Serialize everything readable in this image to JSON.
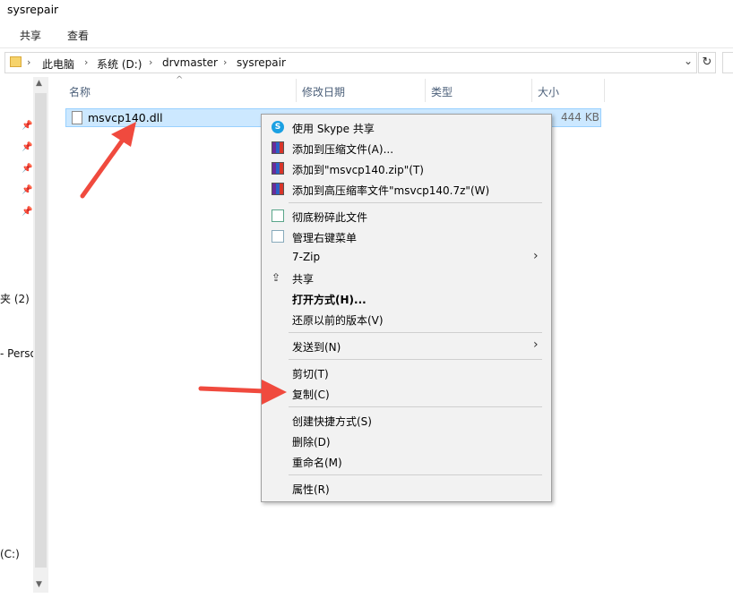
{
  "window": {
    "title": "sysrepair"
  },
  "ribbon": {
    "tabs": [
      "共享",
      "查看"
    ]
  },
  "address_bar": {
    "crumbs": [
      "此电脑",
      "系统 (D:)",
      "drvmaster",
      "sysrepair"
    ],
    "dropdown_icon": "chevron-down-icon",
    "refresh_icon": "refresh-icon"
  },
  "columns": {
    "name": "名称",
    "modified": "修改日期",
    "type": "类型",
    "size": "大小"
  },
  "file": {
    "name": "msvcp140.dll",
    "size": "444 KB"
  },
  "left_pane": {
    "item1": "夹 (2)",
    "item2": "- Perso",
    "item3": "(C:)"
  },
  "context_menu": {
    "items": [
      {
        "label": "使用 Skype 共享",
        "icon": "skype-icon"
      },
      {
        "label": "添加到压缩文件(A)...",
        "icon": "winrar-icon"
      },
      {
        "label": "添加到\"msvcp140.zip\"(T)",
        "icon": "winrar-icon"
      },
      {
        "label": "添加到高压缩率文件\"msvcp140.7z\"(W)",
        "icon": "winrar-icon"
      },
      {
        "label": "彻底粉碎此文件",
        "icon": "shredder-icon"
      },
      {
        "label": "管理右键菜单",
        "icon": "menu-manager-icon"
      },
      {
        "label": "7-Zip",
        "submenu": true
      },
      {
        "label": "共享",
        "icon": "share-icon"
      },
      {
        "label": "打开方式(H)...",
        "bold": true
      },
      {
        "label": "还原以前的版本(V)"
      },
      {
        "label": "发送到(N)",
        "submenu": true
      },
      {
        "label": "剪切(T)"
      },
      {
        "label": "复制(C)"
      },
      {
        "label": "创建快捷方式(S)"
      },
      {
        "label": "删除(D)"
      },
      {
        "label": "重命名(M)"
      },
      {
        "label": "属性(R)"
      }
    ]
  },
  "colors": {
    "selection": "#cce8ff",
    "selection_border": "#99d1ff",
    "menu_bg": "#f2f2f2",
    "annotation_arrow": "#f04a3e"
  }
}
